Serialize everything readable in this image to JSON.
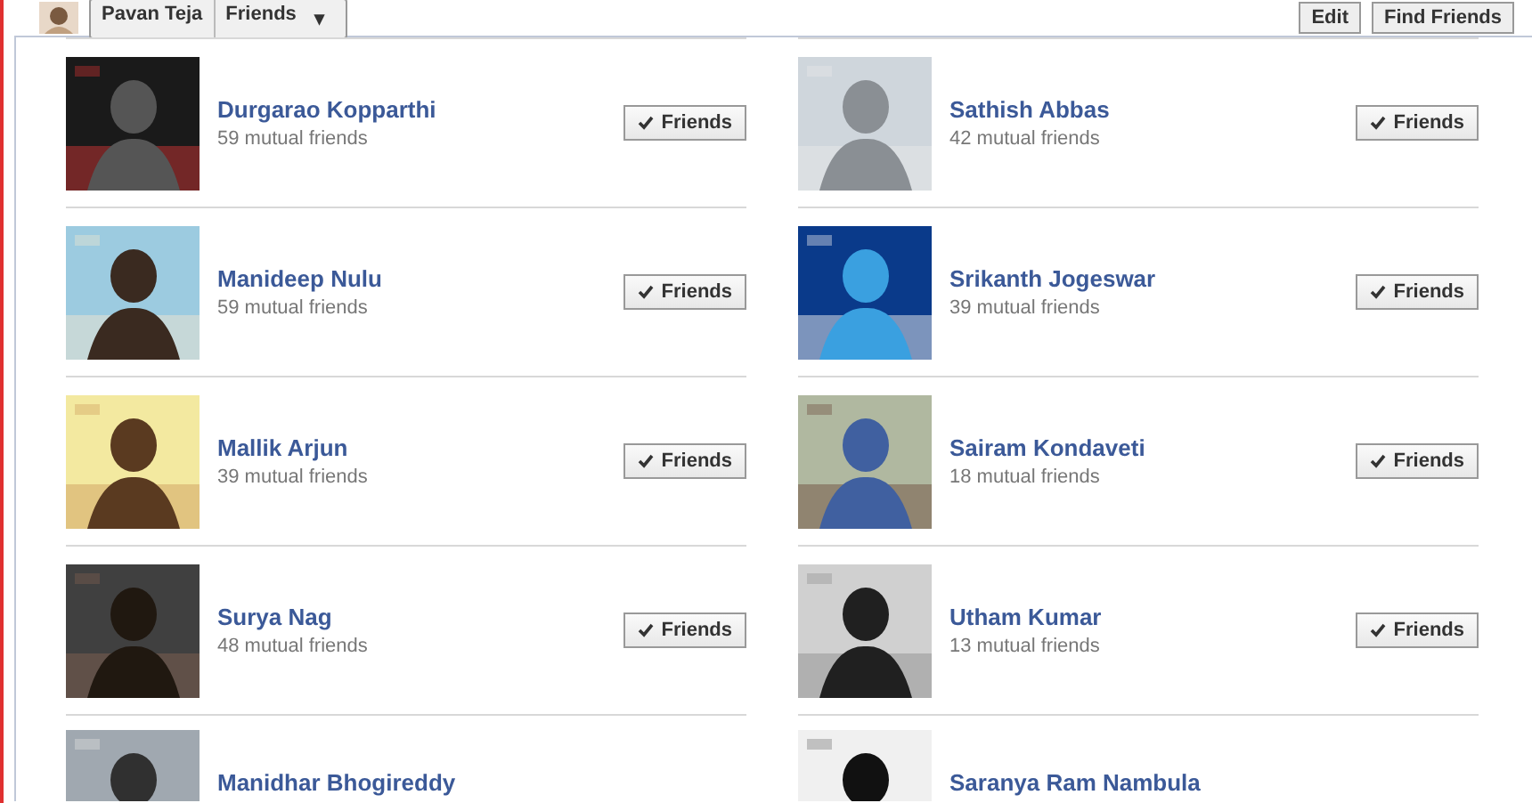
{
  "header": {
    "profile_name": "Pavan Teja",
    "menu_label": "Friends",
    "menu_caret": "▾",
    "buttons": [
      {
        "label": "Edit"
      },
      {
        "label": "Find Friends"
      }
    ]
  },
  "friends": [
    {
      "name": "Durgarao Kopparthi",
      "mutual": "59 mutual friends",
      "button": "Friends",
      "kind": "full"
    },
    {
      "name": "Sathish Abbas",
      "mutual": "42 mutual friends",
      "button": "Friends",
      "kind": "full"
    },
    {
      "name": "Manideep Nulu",
      "mutual": "59 mutual friends",
      "button": "Friends",
      "kind": "full"
    },
    {
      "name": "Srikanth Jogeswar",
      "mutual": "39 mutual friends",
      "button": "Friends",
      "kind": "full"
    },
    {
      "name": "Mallik Arjun",
      "mutual": "39 mutual friends",
      "button": "Friends",
      "kind": "full"
    },
    {
      "name": "Sairam Kondaveti",
      "mutual": "18 mutual friends",
      "button": "Friends",
      "kind": "full"
    },
    {
      "name": "Surya Nag",
      "mutual": "48 mutual friends",
      "button": "Friends",
      "kind": "full"
    },
    {
      "name": "Utham Kumar",
      "mutual": "13 mutual friends",
      "button": "Friends",
      "kind": "full"
    },
    {
      "name": "Manidhar Bhogireddy",
      "kind": "partial"
    },
    {
      "name": "Saranya Ram Nambula",
      "kind": "partial"
    }
  ]
}
